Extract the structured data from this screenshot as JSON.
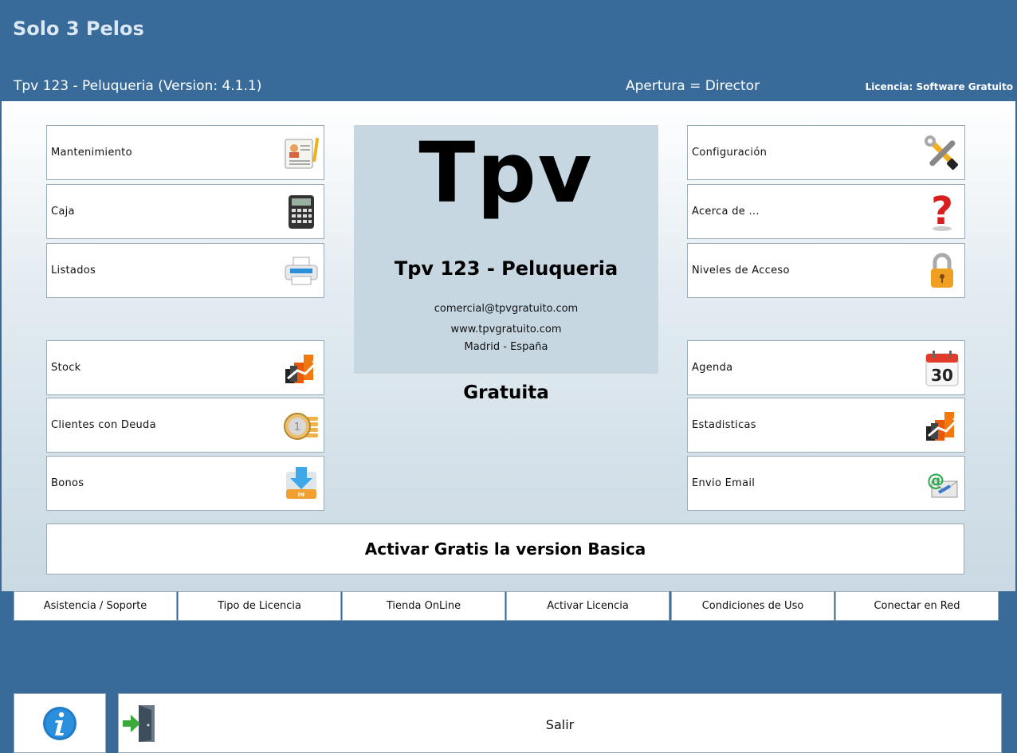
{
  "header": {
    "app_title": "Solo 3 Pelos",
    "subtitle": "Tpv 123 - Peluqueria (Version: 4.1.1)",
    "opening": "Apertura = Director",
    "license": "Licencia: Software Gratuito"
  },
  "left_menu": [
    {
      "label": "Mantenimiento",
      "icon": "contact-card-icon"
    },
    {
      "label": "Caja",
      "icon": "calculator-icon"
    },
    {
      "label": "Listados",
      "icon": "printer-icon"
    },
    {
      "label": "Stock",
      "icon": "bar-chart-icon"
    },
    {
      "label": "Clientes con Deuda",
      "icon": "coins-icon"
    },
    {
      "label": "Bonos",
      "icon": "inbox-download-icon"
    }
  ],
  "right_menu": [
    {
      "label": "Configuración",
      "icon": "tools-icon"
    },
    {
      "label": "Acerca de ...",
      "icon": "question-mark-icon"
    },
    {
      "label": "Niveles de Acceso",
      "icon": "padlock-icon"
    },
    {
      "label": "Agenda",
      "icon": "calendar-icon"
    },
    {
      "label": "Estadisticas",
      "icon": "bar-chart-icon"
    },
    {
      "label": "Envio Email",
      "icon": "email-icon"
    }
  ],
  "calendar_day": "30",
  "card": {
    "logo": "Tpv",
    "name": "Tpv 123 - Peluqueria",
    "email": "comercial@tpvgratuito.com",
    "web": "www.tpvgratuito.com",
    "city": "Madrid - España"
  },
  "free_label": "Gratuita",
  "activate_label": "Activar Gratis la version Basica",
  "bottom_tabs": [
    "Asistencia / Soporte",
    "Tipo de Licencia",
    "Tienda OnLine",
    "Activar Licencia",
    "Condiciones de Uso",
    "Conectar en Red"
  ],
  "exit_label": "Salir",
  "colors": {
    "header_bg": "#386b99",
    "panel_bg": "#dfe8ef",
    "card_bg": "#c7d7e1"
  }
}
